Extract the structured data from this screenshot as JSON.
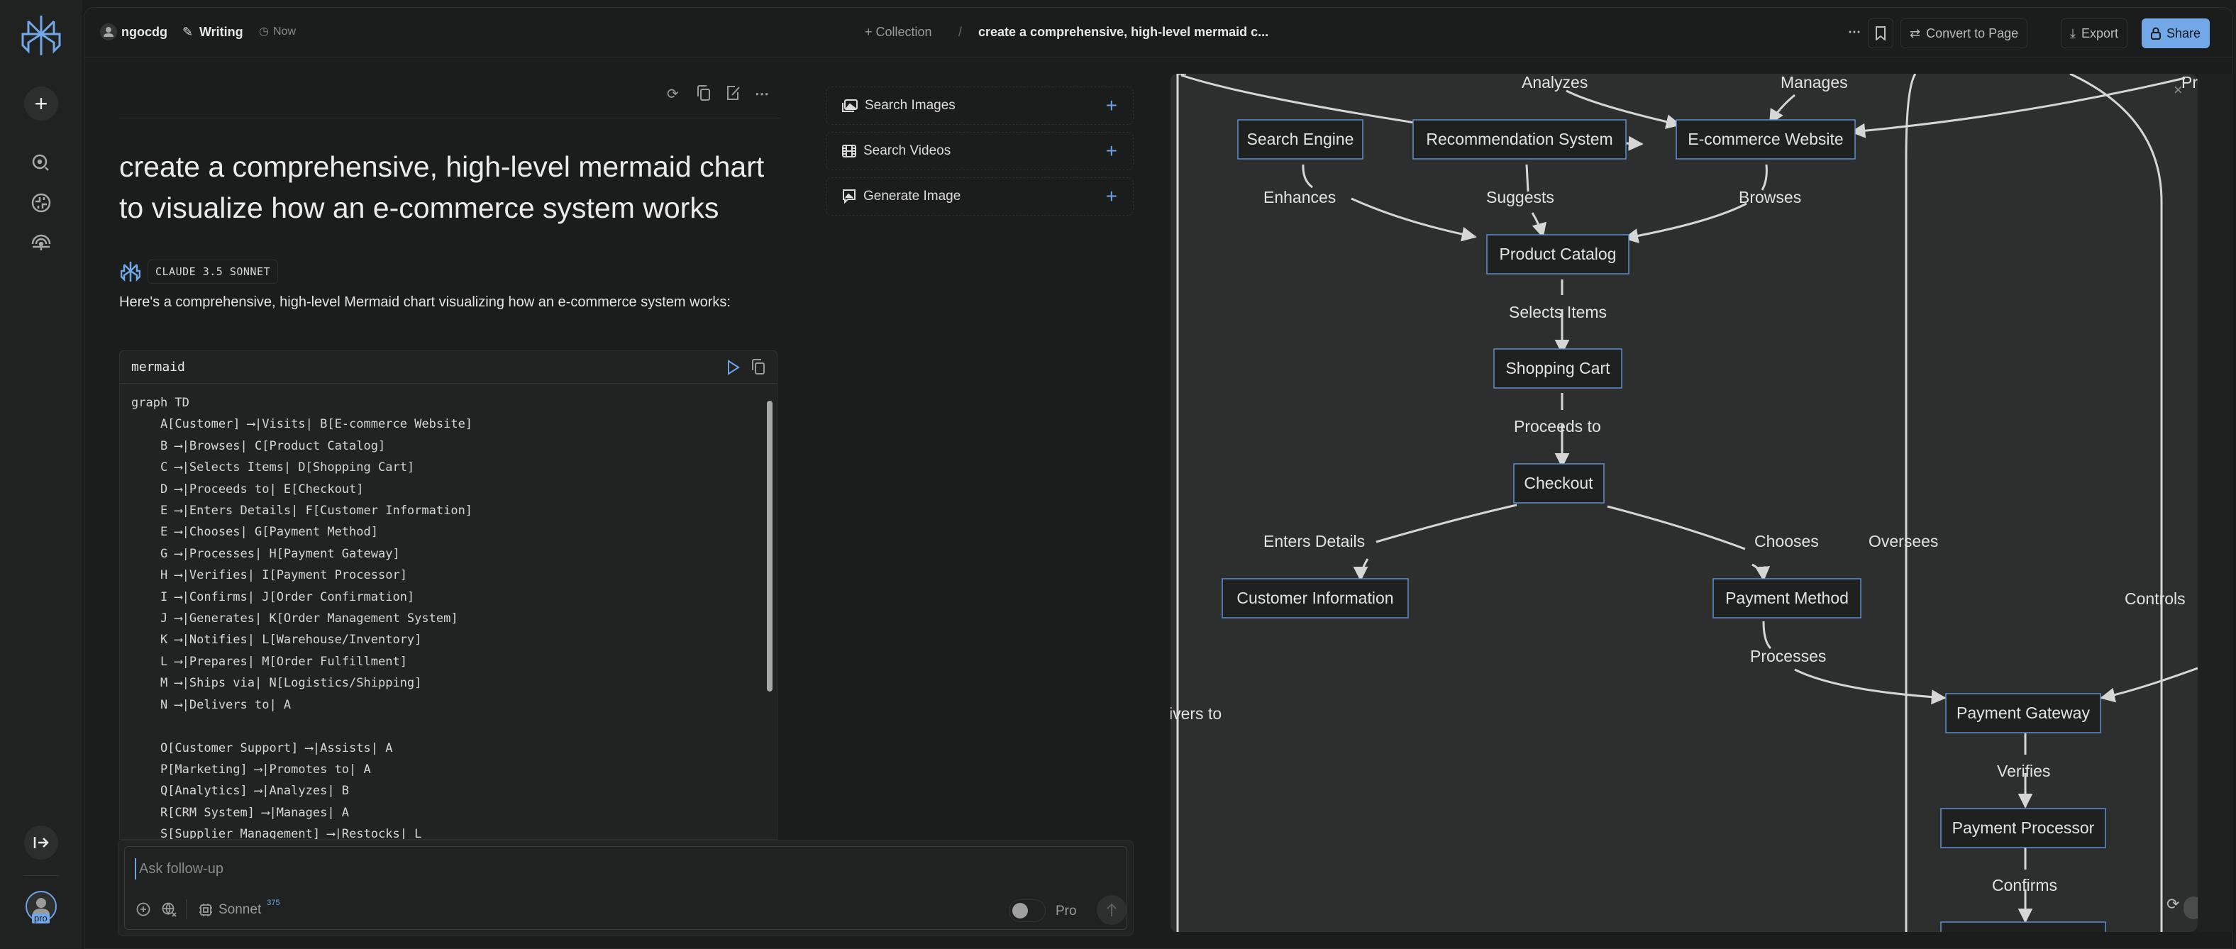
{
  "sidebar": {
    "logo": "perplexity-logo",
    "items": [
      {
        "name": "new-thread",
        "icon": "plus-icon"
      },
      {
        "name": "search",
        "icon": "search-icon"
      },
      {
        "name": "discover",
        "icon": "globe-icon"
      },
      {
        "name": "spaces",
        "icon": "spaces-icon"
      }
    ],
    "collapse_icon": "expand-sidebar-icon",
    "avatar_badge": "pro"
  },
  "topbar": {
    "user": "ngocdg",
    "mode": "Writing",
    "time": "Now",
    "collection_label": "+ Collection",
    "separator": "/",
    "thread_title": "create a comprehensive, high-level mermaid c...",
    "more": "⋯",
    "convert_label": "Convert to Page",
    "export_label": "Export",
    "share_label": "Share",
    "accent": "#72a7e8"
  },
  "thread": {
    "question": "create a comprehensive, high-level mermaid chart to visualize how an e-commerce system works",
    "model_badge": "CLAUDE 3.5 SONNET",
    "answer_intro": "Here's a comprehensive, high-level Mermaid chart visualizing how an e-commerce system works:",
    "code": {
      "language": "mermaid",
      "lines": [
        "graph TD",
        "    A[Customer] ⟶|Visits| B[E-commerce Website]",
        "    B ⟶|Browses| C[Product Catalog]",
        "    C ⟶|Selects Items| D[Shopping Cart]",
        "    D ⟶|Proceeds to| E[Checkout]",
        "    E ⟶|Enters Details| F[Customer Information]",
        "    E ⟶|Chooses| G[Payment Method]",
        "    G ⟶|Processes| H[Payment Gateway]",
        "    H ⟶|Verifies| I[Payment Processor]",
        "    I ⟶|Confirms| J[Order Confirmation]",
        "    J ⟶|Generates| K[Order Management System]",
        "    K ⟶|Notifies| L[Warehouse/Inventory]",
        "    L ⟶|Prepares| M[Order Fulfillment]",
        "    M ⟶|Ships via| N[Logistics/Shipping]",
        "    N ⟶|Delivers to| A",
        "",
        "    O[Customer Support] ⟶|Assists| A",
        "    P[Marketing] ⟶|Promotes to| A",
        "    Q[Analytics] ⟶|Analyzes| B",
        "    R[CRM System] ⟶|Manages| A",
        "    S[Supplier Management] ⟶|Restocks| L"
      ]
    }
  },
  "tools": [
    {
      "label": "Search Images",
      "icon": "image-icon"
    },
    {
      "label": "Search Videos",
      "icon": "film-icon"
    },
    {
      "label": "Generate Image",
      "icon": "generate-image-icon"
    }
  ],
  "composer": {
    "placeholder": "Ask follow-up",
    "model": "Sonnet",
    "model_count": "375",
    "pro_label": "Pro",
    "pro_enabled": false
  },
  "diagram": {
    "nodes": [
      {
        "id": "search",
        "label": "Search Engine"
      },
      {
        "id": "reco",
        "label": "Recommendation System"
      },
      {
        "id": "web",
        "label": "E-commerce Website"
      },
      {
        "id": "catalog",
        "label": "Product Catalog"
      },
      {
        "id": "cart",
        "label": "Shopping Cart"
      },
      {
        "id": "checkout",
        "label": "Checkout"
      },
      {
        "id": "custinfo",
        "label": "Customer Information"
      },
      {
        "id": "paymethod",
        "label": "Payment Method"
      },
      {
        "id": "gateway",
        "label": "Payment Gateway"
      },
      {
        "id": "processor",
        "label": "Payment Processor"
      }
    ],
    "edge_labels": [
      "Analyzes",
      "Manages",
      "Pro",
      "Enhances",
      "Suggests",
      "Browses",
      "Selects Items",
      "Proceeds to",
      "Enters Details",
      "Chooses",
      "Oversees",
      "Controls",
      "Processes",
      "ivers to",
      "Verifies",
      "Confirms"
    ]
  }
}
